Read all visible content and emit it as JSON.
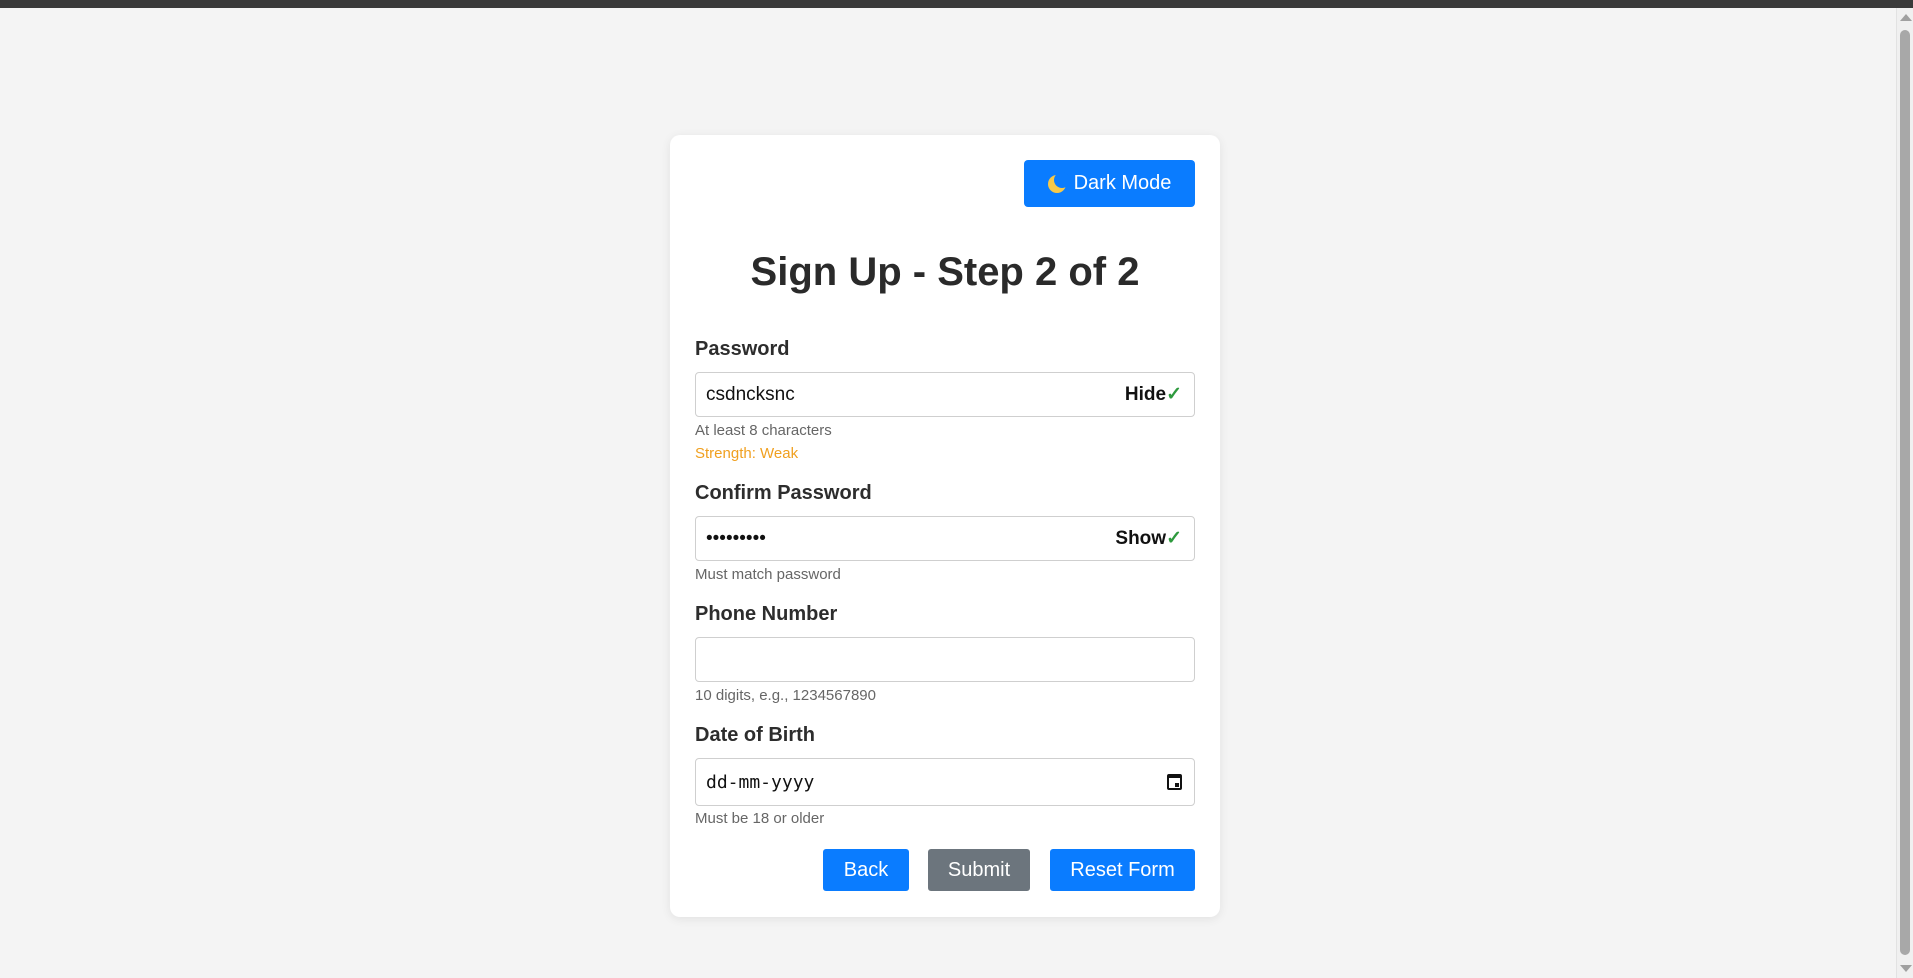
{
  "theme_toggle": {
    "label": "Dark Mode",
    "icon": "moon-icon"
  },
  "form": {
    "title": "Sign Up - Step 2 of 2",
    "password": {
      "label": "Password",
      "value": "csdncksnc",
      "toggle_label": "Hide",
      "valid_mark": "✓",
      "hint": "At least 8 characters",
      "strength": "Strength: Weak"
    },
    "confirm_password": {
      "label": "Confirm Password",
      "value": "•••••••••",
      "toggle_label": "Show",
      "valid_mark": "✓",
      "hint": "Must match password"
    },
    "phone": {
      "label": "Phone Number",
      "value": "",
      "hint": "10 digits, e.g., 1234567890"
    },
    "dob": {
      "label": "Date of Birth",
      "placeholder": "dd-mm-yyyy",
      "hint": "Must be 18 or older"
    },
    "buttons": {
      "back": "Back",
      "submit": "Submit",
      "reset": "Reset Form"
    }
  },
  "colors": {
    "primary": "#0a7cff",
    "secondary": "#6c757d",
    "valid": "#2e9a3e",
    "warning": "#f0a020"
  }
}
